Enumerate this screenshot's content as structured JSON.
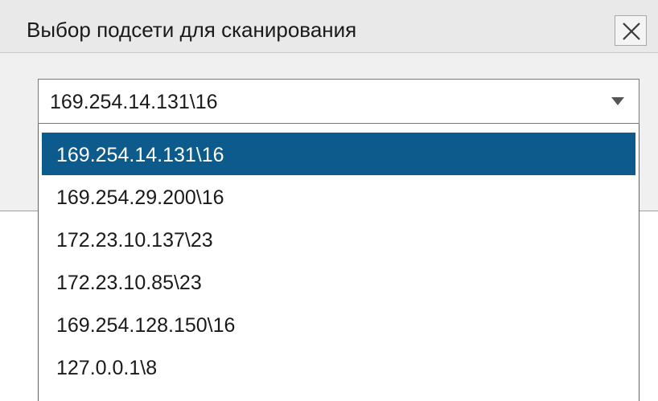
{
  "dialog": {
    "title": "Выбор подсети для сканирования",
    "close_icon": "close-icon"
  },
  "combo": {
    "selected_value": "169.254.14.131\\16",
    "arrow_icon": "dropdown-arrow-icon"
  },
  "dropdown": {
    "options": [
      "169.254.14.131\\16",
      "169.254.29.200\\16",
      "172.23.10.137\\23",
      "172.23.10.85\\23",
      "169.254.128.150\\16",
      "127.0.0.1\\8"
    ],
    "highlighted_index": 0
  },
  "colors": {
    "highlight": "#0d5b8c",
    "titlebar": "#e9e9e9",
    "dialog_bg": "#f0f0f0"
  }
}
